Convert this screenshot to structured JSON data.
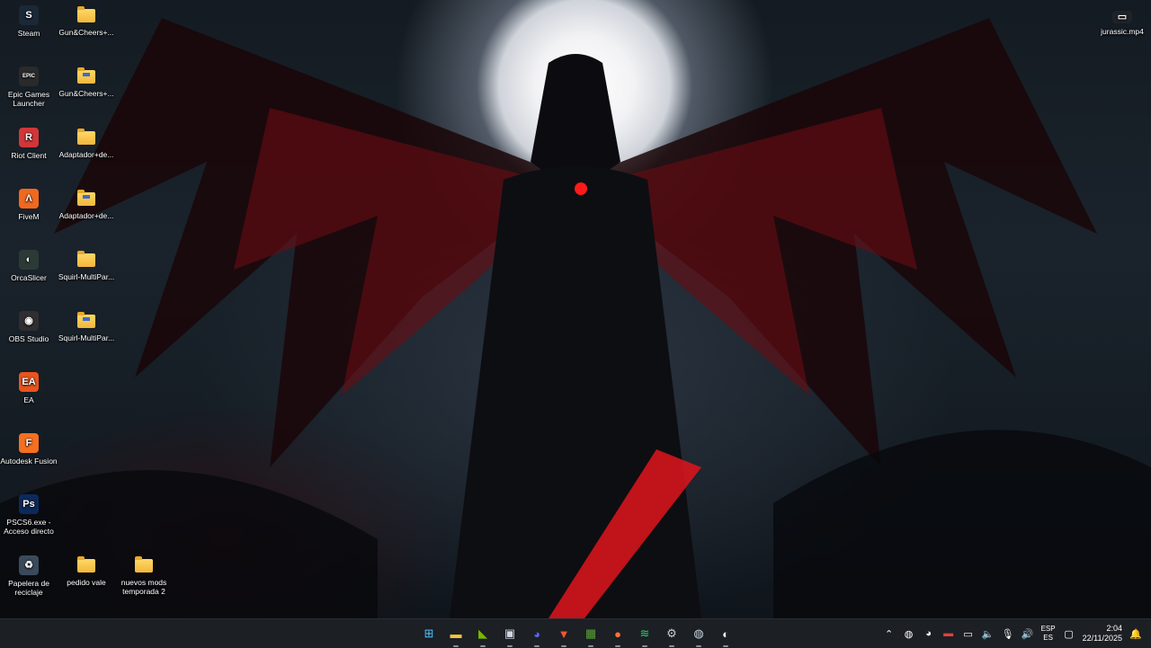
{
  "desktop_icons": [
    {
      "label": "Steam",
      "icon": "steam-icon",
      "color": "#1b2838",
      "glyph": "S",
      "col": 0,
      "row": 0,
      "kind": "app"
    },
    {
      "label": "Epic Games Launcher",
      "icon": "epic-games-icon",
      "color": "#2a2a2a",
      "glyph": "EPIC",
      "col": 0,
      "row": 1,
      "kind": "app"
    },
    {
      "label": "Riot Client",
      "icon": "riot-client-icon",
      "color": "#d13639",
      "glyph": "R",
      "col": 0,
      "row": 2,
      "kind": "app"
    },
    {
      "label": "FiveM",
      "icon": "fivem-icon",
      "color": "#f0691f",
      "glyph": "Λ",
      "col": 0,
      "row": 3,
      "kind": "app"
    },
    {
      "label": "OrcaSlicer",
      "icon": "orcaslicer-icon",
      "color": "#2c3a36",
      "glyph": "◐",
      "col": 0,
      "row": 4,
      "kind": "app"
    },
    {
      "label": "OBS Studio",
      "icon": "obs-studio-icon",
      "color": "#302e31",
      "glyph": "◉",
      "col": 0,
      "row": 5,
      "kind": "app"
    },
    {
      "label": "EA",
      "icon": "ea-icon",
      "color": "#e9541d",
      "glyph": "EA",
      "col": 0,
      "row": 6,
      "kind": "app"
    },
    {
      "label": "Autodesk Fusion",
      "icon": "autodesk-fusion-icon",
      "color": "#f37021",
      "glyph": "F",
      "col": 0,
      "row": 7,
      "kind": "app"
    },
    {
      "label": "PSCS6.exe - Acceso directo",
      "icon": "photoshop-icon",
      "color": "#0b2a5b",
      "glyph": "Ps",
      "col": 0,
      "row": 8,
      "kind": "app"
    },
    {
      "label": "Papelera de reciclaje",
      "icon": "recycle-bin-icon",
      "color": "#3a4a5a",
      "glyph": "♻",
      "col": 0,
      "row": 9,
      "kind": "app"
    },
    {
      "label": "Gun&Cheers+...",
      "icon": "folder-icon",
      "col": 1,
      "row": 0,
      "kind": "folder"
    },
    {
      "label": "Gun&Cheers+...",
      "icon": "zip-folder-icon",
      "col": 1,
      "row": 1,
      "kind": "zip"
    },
    {
      "label": "Adaptador+de...",
      "icon": "folder-icon",
      "col": 1,
      "row": 2,
      "kind": "folder"
    },
    {
      "label": "Adaptador+de...",
      "icon": "zip-folder-icon",
      "col": 1,
      "row": 3,
      "kind": "zip"
    },
    {
      "label": "Squirl-MultiPar...",
      "icon": "folder-icon",
      "col": 1,
      "row": 4,
      "kind": "folder"
    },
    {
      "label": "Squirl-MultiPar...",
      "icon": "zip-folder-icon",
      "col": 1,
      "row": 5,
      "kind": "zip"
    },
    {
      "label": "pedido vale",
      "icon": "folder-icon",
      "col": 1,
      "row": 9,
      "kind": "folder"
    },
    {
      "label": "nuevos mods temporada 2",
      "icon": "folder-icon",
      "col": 2,
      "row": 9,
      "kind": "folder"
    }
  ],
  "right_icon": {
    "label": "jurassic.mp4",
    "icon": "video-file-icon"
  },
  "taskbar": {
    "apps": [
      {
        "name": "start-button",
        "glyph": "⊞",
        "color": "#4cc2ff"
      },
      {
        "name": "file-explorer-icon",
        "glyph": "▬",
        "color": "#f5c242"
      },
      {
        "name": "nvidia-icon",
        "glyph": "◣",
        "color": "#76b900"
      },
      {
        "name": "microsoft-store-icon",
        "glyph": "▣",
        "color": "#cfd8e3"
      },
      {
        "name": "discord-icon",
        "glyph": "◕",
        "color": "#5865f2"
      },
      {
        "name": "brave-icon",
        "glyph": "▼",
        "color": "#fb542b"
      },
      {
        "name": "minecraft-icon",
        "glyph": "▦",
        "color": "#5aa13b"
      },
      {
        "name": "firefox-icon",
        "glyph": "●",
        "color": "#ff7139"
      },
      {
        "name": "spotify-icon",
        "glyph": "≋",
        "color": "#1ed760"
      },
      {
        "name": "settings-gear-icon",
        "glyph": "⚙",
        "color": "#c9ccd1"
      },
      {
        "name": "steam-taskbar-icon",
        "glyph": "◍",
        "color": "#c7d5e0"
      },
      {
        "name": "orcaslicer-taskbar-icon",
        "glyph": "◐",
        "color": "#e6f2ee"
      }
    ],
    "tray": {
      "language_top": "ESP",
      "language_bottom": "ES",
      "time": "2:04",
      "date": "22/11/2025"
    }
  }
}
